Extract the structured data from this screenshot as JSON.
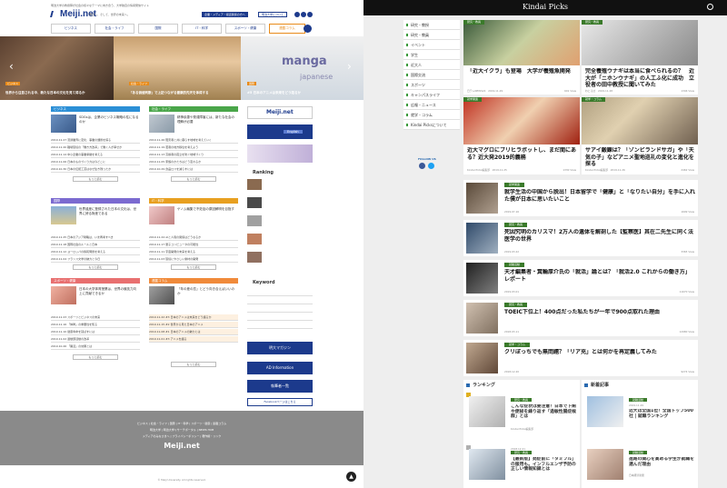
{
  "left": {
    "header_note": "明治大学の教授陣が社会の様々なテーマに向き合う、大学独自の情報発信サイト",
    "logo": "Meiji.net",
    "tagline": "明日へ、そして、世界の未来へ。",
    "header_btn1": "企業・メディア・報道関係の方へ",
    "header_btn2": "明治大学について",
    "nav": [
      "ビジネス",
      "社会・ライフ",
      "国際",
      "IT・科学",
      "スポーツ・健康",
      "連載コラム"
    ],
    "hero": [
      {
        "caption": "世界から注目される中、新たな日本の文化を見て得るか",
        "tag": "ビジネス"
      },
      {
        "caption": "「ある価値判断」で上記つながる健康的先天を体得する",
        "tag": "社会・ライフ"
      },
      {
        "caption": "#5 日本のアニメは未来をどう語るか",
        "tag": "国際",
        "words": [
          "manga",
          "japanese"
        ]
      }
    ],
    "sections": [
      {
        "name": "ビジネス",
        "color": "#2b8fd6",
        "title": "SDGsは、企業のビジネス戦略の柱になるのか",
        "rows": [
          "2019.11.27 流通業界に変化、事業の課題を探る",
          "2019.11.20 職場環境の「働き方改革」で働く人が幸せか",
          "2019.11.14 中小企業の事業承継を考える",
          "2019.11.06 日本のものづくり力は今どこに",
          "2019.10.30 日本の伝統工芸はなぜ生き残ったか"
        ],
        "more": "もっと読む"
      },
      {
        "name": "社会・ライフ",
        "color": "#4aa64a",
        "title": "精神疾患や発達障害には、新たな社会の理解が必要",
        "rows": [
          "2019.11.26 障害者と共に暮らす地域を考えていく",
          "2019.11.19 若者の地方移住を考えよう",
          "2019.11.13 高齢者の孤立を防ぐ地域づくり",
          "2019.11.05 家族のかたちはどう変わるか",
          "2019.10.29 食品ロスを減らすには"
        ],
        "more": "もっと読む"
      },
      {
        "name": "国際",
        "color": "#7b6ad0",
        "title": "世界遺産に登録された日本の文化は、世界に誇る財産である",
        "rows": [
          "2019.11.25 日本のアジア戦略は、いま再考すべき",
          "2019.11.18 国際社会のルールと日本",
          "2019.11.12 ヨーロッパの移民問題を考える",
          "2019.11.04 フランス文学の魅力と今日"
        ],
        "more": "もっと読む"
      },
      {
        "name": "IT・科学",
        "color": "#e8a020",
        "title": "ゲノム編集で不妊症の原因解明を目指す",
        "rows": [
          "2019.11.24 AIと人間の関係はどうなるか",
          "2019.11.17 量子コンピュータの可能性",
          "2019.11.11 宇宙開発の未来を考える",
          "2019.11.03 環境にやさしい素材の開発"
        ],
        "more": "もっと読む"
      },
      {
        "name": "スポーツ・健康",
        "color": "#e87070",
        "title": "日本の大学体育授業は、世界の競技力向上に貢献できるか",
        "rows": [
          "2019.11.23 スポーツとビジネスの未来",
          "2019.11.16 「体幹」の重要性を知る",
          "2019.11.10 健康寿命を延ばすには",
          "2019.11.02 運動部活動の改革",
          "2019.10.26 「腸活」の効果とは"
        ],
        "more": "もっと読む"
      },
      {
        "name": "連載コラム",
        "color": "#f08a3a",
        "title": "「年の差の恋」とどう向き合えばいいのか",
        "rows": [
          "2019.11.22 #3 日本のアニメは未来をどう語るか",
          "2019.11.15 #2 世界から見た日本のアニメ",
          "2019.11.08 #1 日本のアニメの魅力とは",
          "2019.11.01 #3 アニメを語る"
        ],
        "more": "もっと読む"
      }
    ],
    "sidebar": {
      "brand": "Meiji.net",
      "english": "English",
      "ranking": "Ranking",
      "keyword": "Keyword",
      "buttons": [
        "明大マガジン",
        "AD Information",
        "執筆者一覧"
      ],
      "facebook": "Facebookページはこちら"
    },
    "footer_links": "ビジネス | 社会・ライフ | 国際 | IT・科学 | スポーツ・健康 | 連載コラム",
    "footer_links2": "明治大学 | 明治大学リサーチポータル | NEWS HUB",
    "footer_links3": "メディアのみなさまへ | プライバシーポリシー | 著作権・リンク",
    "footer_logo": "Meiji.net",
    "copyright": "© Meiji University. All rights reserved."
  },
  "right": {
    "title": "Kindai Picks",
    "nav": [
      "研究・教授",
      "研究・教員",
      "イベント",
      "学生",
      "近大人",
      "国際交流",
      "スポーツ",
      "キャンパスライフ",
      "広報・ニュース",
      "就学・コラム",
      "Kindai Picksについて"
    ],
    "follow": "FOLLOW US",
    "cards": [
      {
        "label": "研究・教員",
        "title": "「近大イクラ」も登場　大学が養殖魚開発",
        "meta": "日テレNEWS24　2019.11.29",
        "views": "601 View"
      },
      {
        "label": "研究・教員",
        "title": "完全養殖ウナギは本当に食べられるの？　近大が「ニホンウナギ」の人工ふ化に成功　立役者の田中教授に聞いてみた",
        "meta": "ねとらぼ　2019.11.28",
        "views": "1346 View"
      },
      {
        "label": "就学関連",
        "title": "近大マグロにブリヒラボットし、まだ間にある？近大発2019的義務",
        "meta": "Kindai Picks編集部　2019.11.25",
        "views": "1330 View"
      },
      {
        "label": "就学・コラム",
        "title": "サアイ鍛錬は？「ゾンビランドサガ」や「天気の子」などアニメ聖地巡礼の変化と進化を探る",
        "meta": "Kindai Picks編集部　2019.11.26",
        "views": "2462 View"
      }
    ],
    "list": [
      {
        "label": "就学関連",
        "title": "就学生活の中国から脱出！日本留学で「健康」と「なりたい自分」を手に入れた僕が日本に思いたいこと",
        "meta": "2019.07.16",
        "views": "1699 View"
      },
      {
        "label": "研究・教員",
        "title": "死因究明のカリスマ！2万人の遺体を解剖した【監察医】其在二先生に同く法医学の世界",
        "meta": "2019.03.22",
        "views": "3365 View"
      },
      {
        "label": "就職活動",
        "title": "天才編集者・箕輪厚介氏の「就活」論とは？「就活2.0 これからの働き方」レポート",
        "meta": "2019.03.01",
        "views": "11670 View"
      },
      {
        "label": "研究・教員",
        "title": "TOEIC下位上！400点だった私たちが一年で900点取れた理由",
        "meta": "2018.03.11",
        "views": "12980 View"
      },
      {
        "label": "就学・コラム",
        "title": "クリぼっちでも無問題？「リア充」とは何かを再定義してみた",
        "meta": "2018.12.20",
        "views": "9274 View"
      }
    ],
    "ranking": "ランキング",
    "newest": "新着記事",
    "ranking_items": [
      {
        "label": "研究・教員",
        "title": "こんな症状は要注意！日本で下痢や便秘を繰り返す「過敏性腸症候群」とは",
        "meta": "Kindai Picks編集部"
      },
      {
        "label": "研究・教員",
        "title": "【最新版】発症前に「タミフル」の服用も。インフルエンザ予防の正しい情報知識とは",
        "meta": "2018.12.21"
      }
    ],
    "new_items": [
      {
        "label": "就職活動",
        "title": "近大は全国1位！全国トップ500社 | 就職ランキング",
        "meta": "2019.11.29"
      },
      {
        "label": "就職活動",
        "title": "進路の関心を高める学生が就職を選んだ理由",
        "meta": "日本経済新聞"
      }
    ]
  }
}
